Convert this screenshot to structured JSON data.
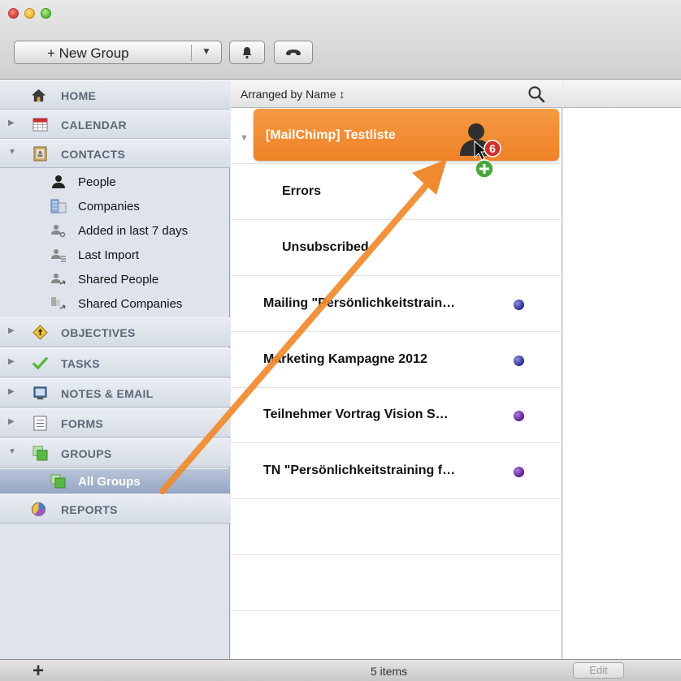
{
  "toolbar": {
    "new_group_label": "+ New Group"
  },
  "sidebar": {
    "sections": {
      "home": "HOME",
      "calendar": "CALENDAR",
      "contacts": "CONTACTS",
      "objectives": "OBJECTIVES",
      "tasks": "TASKS",
      "notes_email": "NOTES & EMAIL",
      "forms": "FORMS",
      "groups": "GROUPS",
      "reports": "REPORTS"
    },
    "contacts_items": [
      "People",
      "Companies",
      "Added in last 7 days",
      "Last Import",
      "Shared People",
      "Shared Companies"
    ],
    "groups_items": [
      "All Groups"
    ]
  },
  "list": {
    "sort_label": "Arranged by Name ↕",
    "drag_target": "[MailChimp] Testliste",
    "drag_badge": "6",
    "rows": [
      {
        "label": "Errors",
        "dot": null
      },
      {
        "label": "Unsubscribed",
        "dot": null
      },
      {
        "label": "Mailing \"Persönlichkeitstrain…",
        "dot": "#2b2b8c"
      },
      {
        "label": "Marketing Kampagne 2012",
        "dot": "#2b2b8c"
      },
      {
        "label": "Teilnehmer Vortrag Vision S…",
        "dot": "#5a1a8c"
      },
      {
        "label": "TN \"Persönlichkeitstraining f…",
        "dot": "#5a1a8c"
      }
    ]
  },
  "status": {
    "item_count": "5 items",
    "edit_label": "Edit"
  },
  "colors": {
    "accent_orange": "#ef8226",
    "arrow": "#f08a2e",
    "selection": "#95a6c4"
  }
}
